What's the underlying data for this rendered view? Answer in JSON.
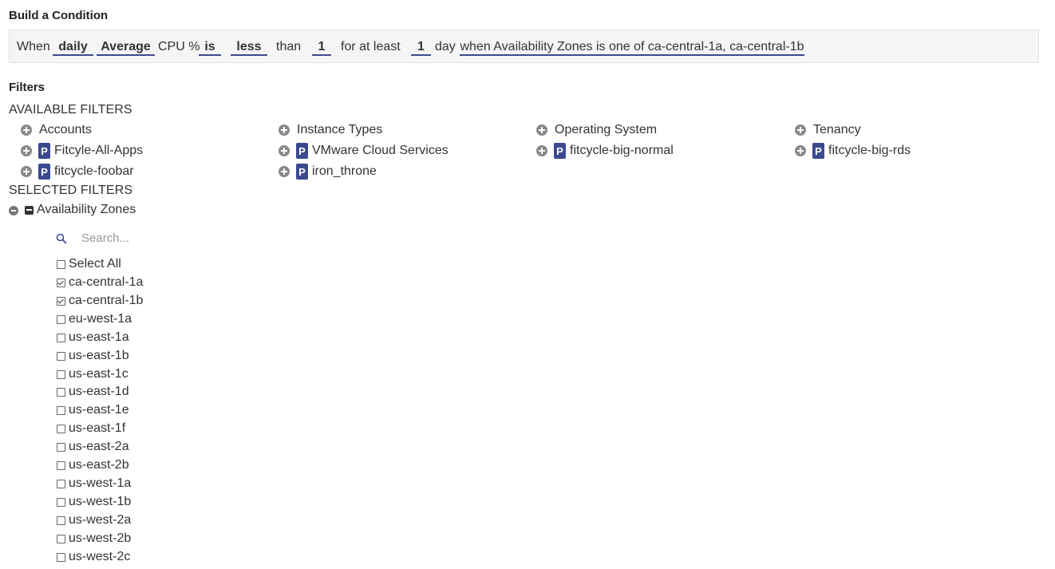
{
  "condition": {
    "title": "Build a Condition",
    "when": "When",
    "period": "daily",
    "aggregate": "Average",
    "metric": "CPU %",
    "operator": "is",
    "comparison": "less",
    "than": "than",
    "threshold": "1",
    "for_at_least": "for at least",
    "duration": "1",
    "duration_unit": "day",
    "filter_summary": "when Availability Zones is one of ca-central-1a, ca-central-1b"
  },
  "filters": {
    "title": "Filters",
    "available_label": "AVAILABLE FILTERS",
    "selected_label": "SELECTED FILTERS",
    "available": [
      {
        "label": "Accounts",
        "badge": ""
      },
      {
        "label": "Instance Types",
        "badge": ""
      },
      {
        "label": "Operating System",
        "badge": ""
      },
      {
        "label": "Tenancy",
        "badge": ""
      },
      {
        "label": "Fitcyle-All-Apps",
        "badge": "P"
      },
      {
        "label": "VMware Cloud Services",
        "badge": "P"
      },
      {
        "label": "fitcycle-big-normal",
        "badge": "P"
      },
      {
        "label": "fitcycle-big-rds",
        "badge": "P"
      },
      {
        "label": "fitcycle-foobar",
        "badge": "P"
      },
      {
        "label": "iron_throne",
        "badge": "P"
      }
    ],
    "selected": {
      "title": "Availability Zones",
      "search_placeholder": "Search...",
      "select_all_label": "Select All",
      "options": [
        {
          "label": "ca-central-1a",
          "checked": true
        },
        {
          "label": "ca-central-1b",
          "checked": true
        },
        {
          "label": "eu-west-1a",
          "checked": false
        },
        {
          "label": "us-east-1a",
          "checked": false
        },
        {
          "label": "us-east-1b",
          "checked": false
        },
        {
          "label": "us-east-1c",
          "checked": false
        },
        {
          "label": "us-east-1d",
          "checked": false
        },
        {
          "label": "us-east-1e",
          "checked": false
        },
        {
          "label": "us-east-1f",
          "checked": false
        },
        {
          "label": "us-east-2a",
          "checked": false
        },
        {
          "label": "us-east-2b",
          "checked": false
        },
        {
          "label": "us-west-1a",
          "checked": false
        },
        {
          "label": "us-west-1b",
          "checked": false
        },
        {
          "label": "us-west-2a",
          "checked": false
        },
        {
          "label": "us-west-2b",
          "checked": false
        },
        {
          "label": "us-west-2c",
          "checked": false
        }
      ]
    }
  },
  "colors": {
    "accent": "#3b4a8f",
    "icon_gray": "#888888"
  }
}
